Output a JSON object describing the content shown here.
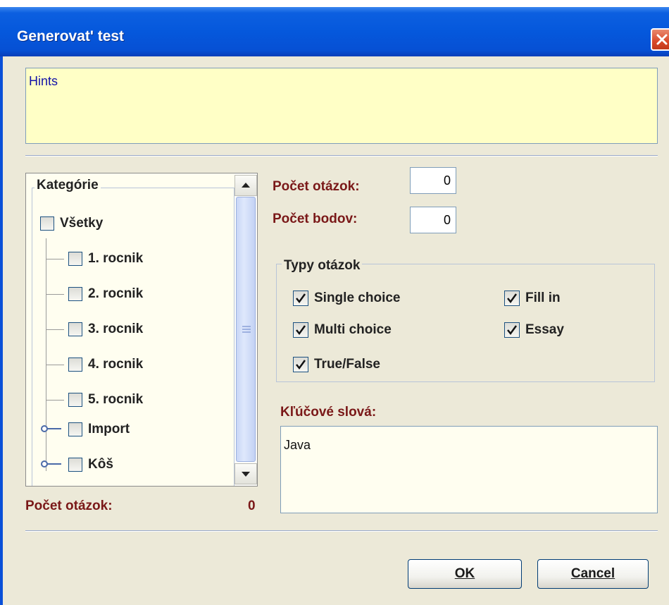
{
  "window": {
    "title": "Generovat' test"
  },
  "hints": {
    "text": "Hints"
  },
  "categories": {
    "legend": "Kategórie",
    "root": "Všetky",
    "items": [
      "1. rocnik",
      "2. rocnik",
      "3. rocnik",
      "4. rocnik",
      "5. rocnik",
      "Import",
      "Kôš"
    ]
  },
  "bottom": {
    "count_label": "Počet otázok:",
    "count_value": "0"
  },
  "form": {
    "question_count_label": "Počet otázok:",
    "question_count_value": "0",
    "points_label": "Počet bodov:",
    "points_value": "0"
  },
  "types": {
    "legend": "Typy otázok",
    "single": "Single choice",
    "multi": "Multi choice",
    "truefalse": "True/False",
    "fillin": "Fill in",
    "essay": "Essay"
  },
  "keywords": {
    "label": "Kľúčové slová:",
    "value": "Java"
  },
  "buttons": {
    "ok": "OK",
    "cancel": "Cancel"
  }
}
